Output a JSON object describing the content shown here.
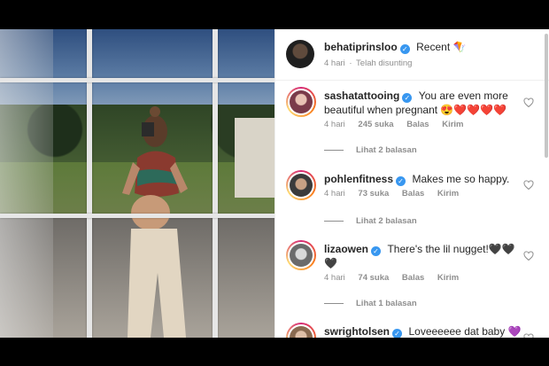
{
  "post": {
    "author": "behatiprinsloo",
    "caption": "Recent 🪁",
    "time": "4 hari",
    "edited": "Telah disunting"
  },
  "comments": [
    {
      "username": "sashatattooing",
      "text": "You are even more beautiful when pregnant 😍❤️❤️❤️❤️",
      "time": "4 hari",
      "likes": "245 suka",
      "reply": "Balas",
      "send": "Kirim",
      "view_replies": "Lihat 2 balasan"
    },
    {
      "username": "pohlenfitness",
      "text": "Makes me so happy.",
      "time": "4 hari",
      "likes": "73 suka",
      "reply": "Balas",
      "send": "Kirim",
      "view_replies": "Lihat 2 balasan"
    },
    {
      "username": "lizaowen",
      "text": "There's the lil nugget!🖤🖤🖤",
      "time": "4 hari",
      "likes": "74 suka",
      "reply": "Balas",
      "send": "Kirim",
      "view_replies": "Lihat 1 balasan"
    },
    {
      "username": "swrightolsen",
      "text": "Loveeeeee dat baby 💜"
    }
  ],
  "colors": {
    "verified": "#3897f0",
    "meta_gray": "#8e8e8e",
    "text": "#262626",
    "story_ring_start": "#d62976",
    "story_ring_end": "#feda75"
  },
  "icons": [
    "verified-badge-icon",
    "heart-icon"
  ]
}
